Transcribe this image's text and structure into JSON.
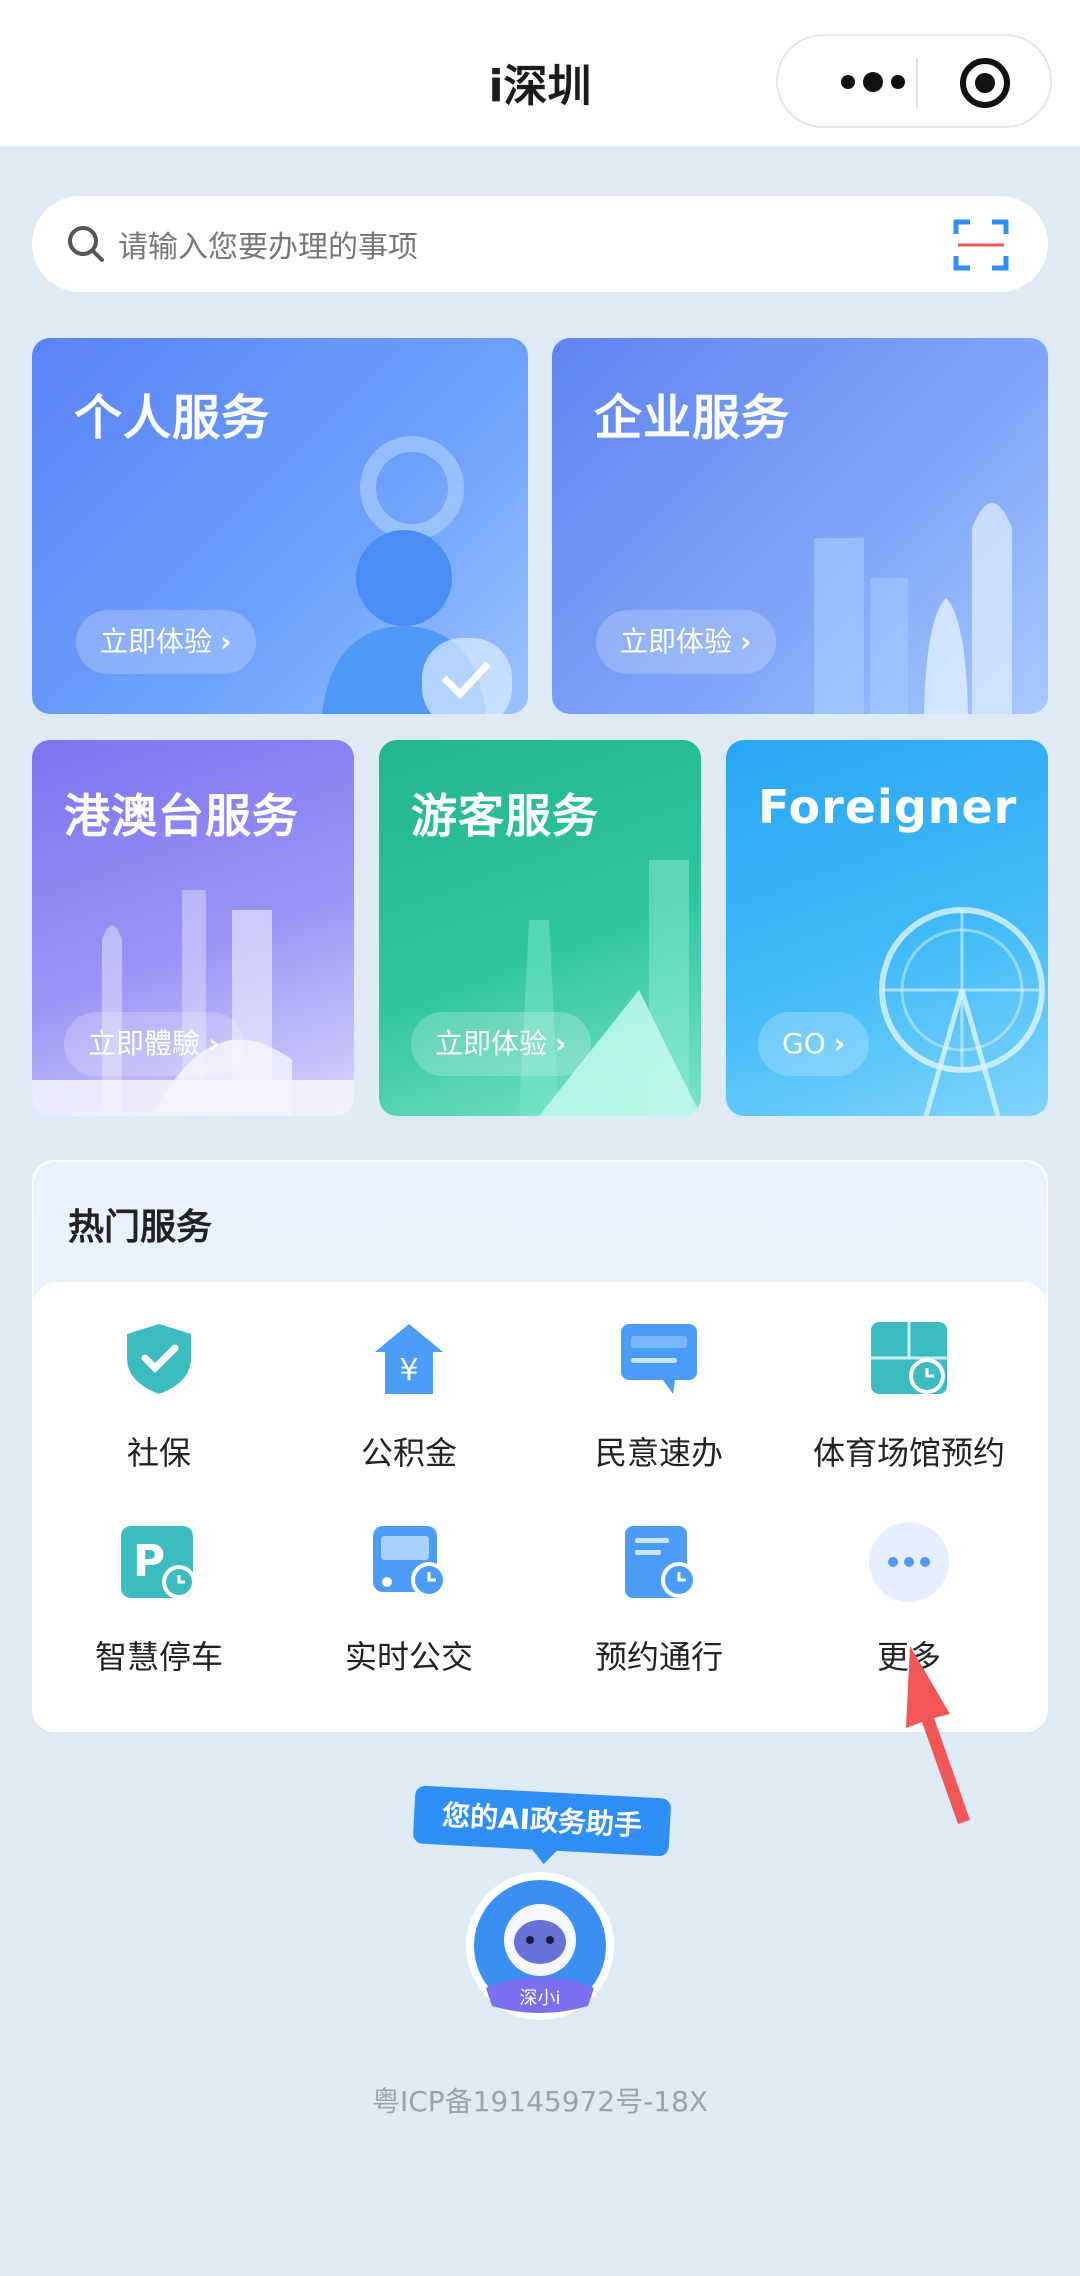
{
  "header": {
    "title": "i深圳",
    "more_icon": "more-dots-icon",
    "close_icon": "target-close-icon"
  },
  "search": {
    "placeholder": "请输入您要办理的事项",
    "search_icon": "search-icon",
    "scan_icon": "scan-icon"
  },
  "cards": {
    "personal": {
      "title": "个人服务",
      "button": "立即体验"
    },
    "company": {
      "title": "企业服务",
      "button": "立即体验"
    },
    "hk": {
      "title": "港澳台服务",
      "button": "立即體驗"
    },
    "tourist": {
      "title": "游客服务",
      "button": "立即体验"
    },
    "foreigner": {
      "title": "Foreigner",
      "button": "GO"
    }
  },
  "hot": {
    "title": "热门服务",
    "items": [
      {
        "label": "社保",
        "icon": "shield-check-icon"
      },
      {
        "label": "公积金",
        "icon": "house-yuan-icon"
      },
      {
        "label": "民意速办",
        "icon": "chat-bubble-icon"
      },
      {
        "label": "体育场馆预约",
        "icon": "stadium-clock-icon"
      },
      {
        "label": "智慧停车",
        "icon": "parking-icon"
      },
      {
        "label": "实时公交",
        "icon": "bus-clock-icon"
      },
      {
        "label": "预约通行",
        "icon": "document-clock-icon"
      },
      {
        "label": "更多",
        "icon": "more-icon"
      }
    ]
  },
  "ai": {
    "bubble": "您的AI政务助手",
    "avatar_label": "深小i"
  },
  "footer": {
    "icp": "粤ICP备19145972号-18X"
  },
  "colors": {
    "primary": "#2f8ff6",
    "background": "#dfeaf7",
    "tourist": "#2ec5a0",
    "arrow": "#f25656"
  }
}
